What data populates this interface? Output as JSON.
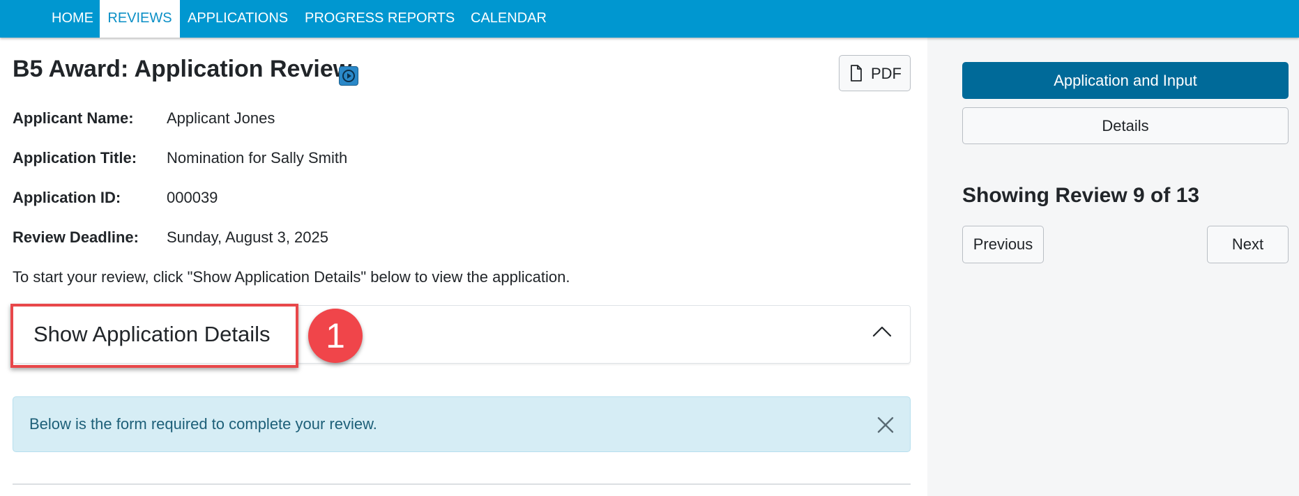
{
  "nav": {
    "items": [
      {
        "label": "HOME",
        "active": false
      },
      {
        "label": "REVIEWS",
        "active": true
      },
      {
        "label": "APPLICATIONS",
        "active": false
      },
      {
        "label": "PROGRESS REPORTS",
        "active": false
      },
      {
        "label": "CALENDAR",
        "active": false
      }
    ]
  },
  "header": {
    "title": "B5 Award: Application Review",
    "video_icon": "play-video-icon",
    "pdf_icon": "document-icon",
    "pdf_label": "PDF"
  },
  "fields": [
    {
      "label": "Applicant Name:",
      "value": "Applicant Jones"
    },
    {
      "label": "Application Title:",
      "value": "Nomination for Sally Smith"
    },
    {
      "label": "Application ID:",
      "value": "000039"
    },
    {
      "label": "Review Deadline:",
      "value": "Sunday, August 3, 2025"
    }
  ],
  "instruction": "To start your review, click \"Show Application Details\" below to view the application.",
  "accordion": {
    "title": "Show Application Details",
    "expanded": true,
    "chevron_icon": "chevron-up-icon"
  },
  "annotation": {
    "step_number": "1",
    "highlight_color": "#e8474a",
    "badge_color": "#f0454a"
  },
  "alert": {
    "text": "Below is the form required to complete your review.",
    "close_icon": "close-icon"
  },
  "sidebar": {
    "primary_button": "Application and Input",
    "details_button": "Details",
    "review_count": "Showing Review 9 of 13",
    "previous_button": "Previous",
    "next_button": "Next"
  },
  "colors": {
    "nav_bg": "#0097d0",
    "primary_button_bg": "#006a99",
    "alert_bg": "#d6edf5",
    "alert_text": "#1d5f78",
    "sidebar_bg": "#f5f6f7"
  }
}
